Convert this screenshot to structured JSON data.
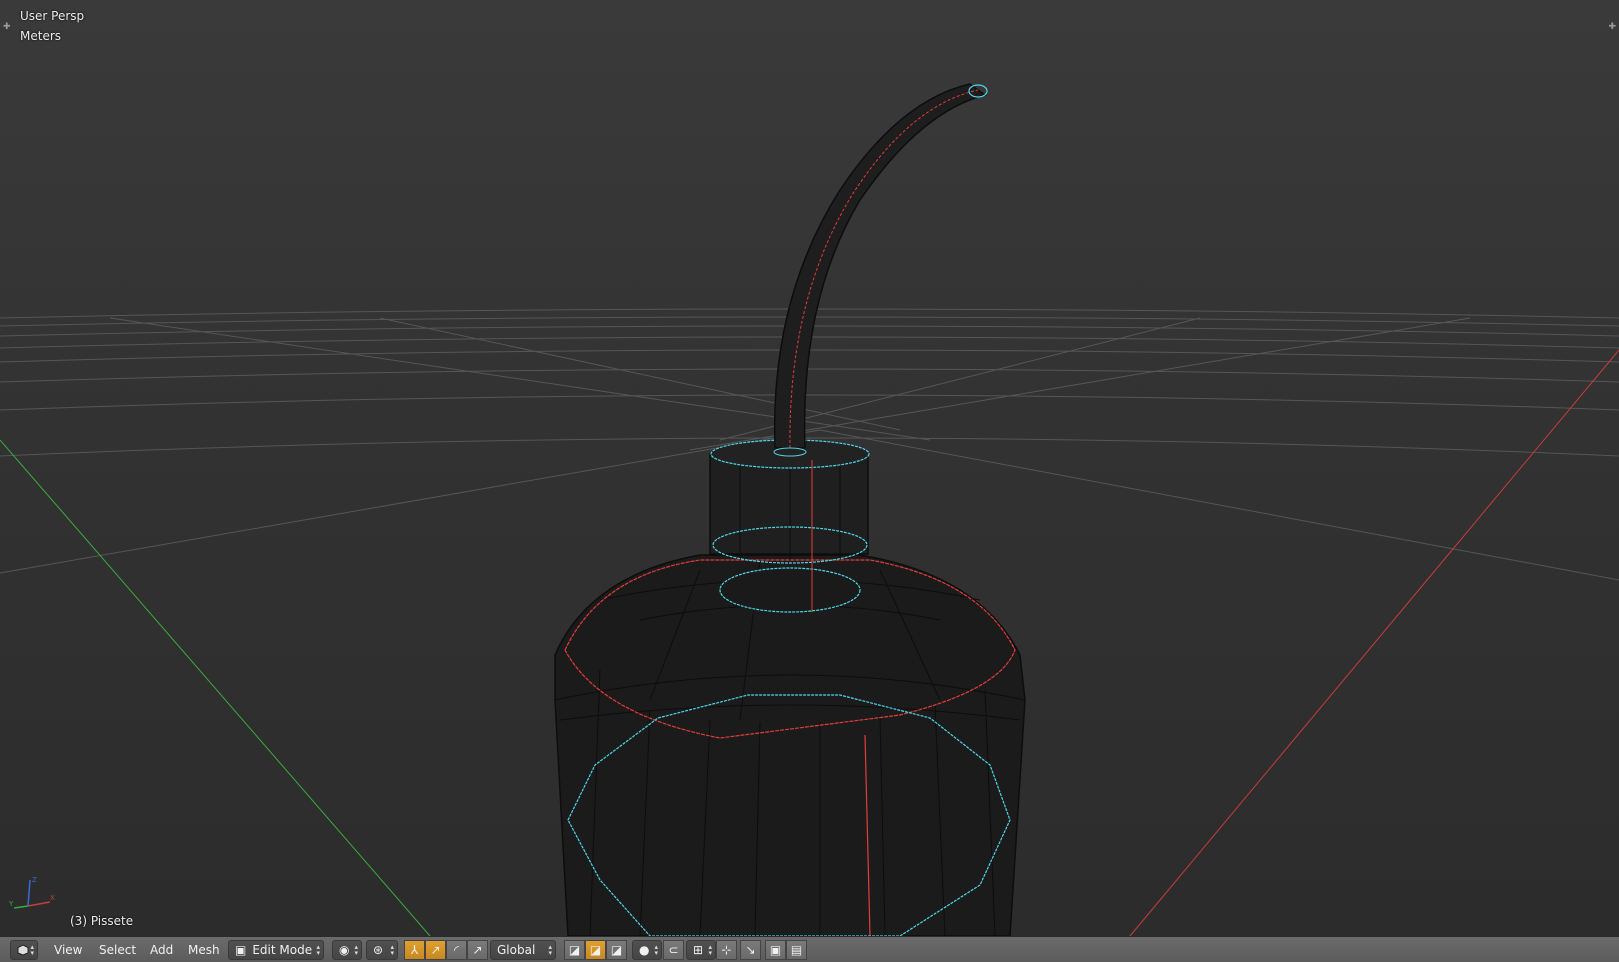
{
  "viewport": {
    "view_name": "User Persp",
    "units": "Meters",
    "object_name": "(3) Pissete",
    "axis_labels": {
      "x": "X",
      "y": "Y",
      "z": "Z"
    },
    "colors": {
      "x_axis": "#c83c3c",
      "y_axis": "#3caa3c",
      "selected_edge": "#4fd6e6",
      "seam": "#e23c3c",
      "grid": "#5a5a5a",
      "wire": "#0d0d0d"
    }
  },
  "header": {
    "editor_type_icon": "3d-view-icon",
    "menus": [
      "View",
      "Select",
      "Add",
      "Mesh"
    ],
    "mode_label": "Edit Mode",
    "shading_icon": "solid-sphere-icon",
    "pivot_icon": "pivot-point-icon",
    "manipulator_icons": [
      "translate-icon",
      "rotate-icon",
      "scale-icon"
    ],
    "orientation_label": "Global",
    "select_mode_icons": [
      "vertex-select-icon",
      "edge-select-icon",
      "face-select-icon"
    ],
    "proportional_icon": "proportional-edit-icon",
    "snap_icons": [
      "snap-icon",
      "snap-element-icon"
    ],
    "render_icons": [
      "render-image-icon",
      "render-anim-icon"
    ]
  }
}
